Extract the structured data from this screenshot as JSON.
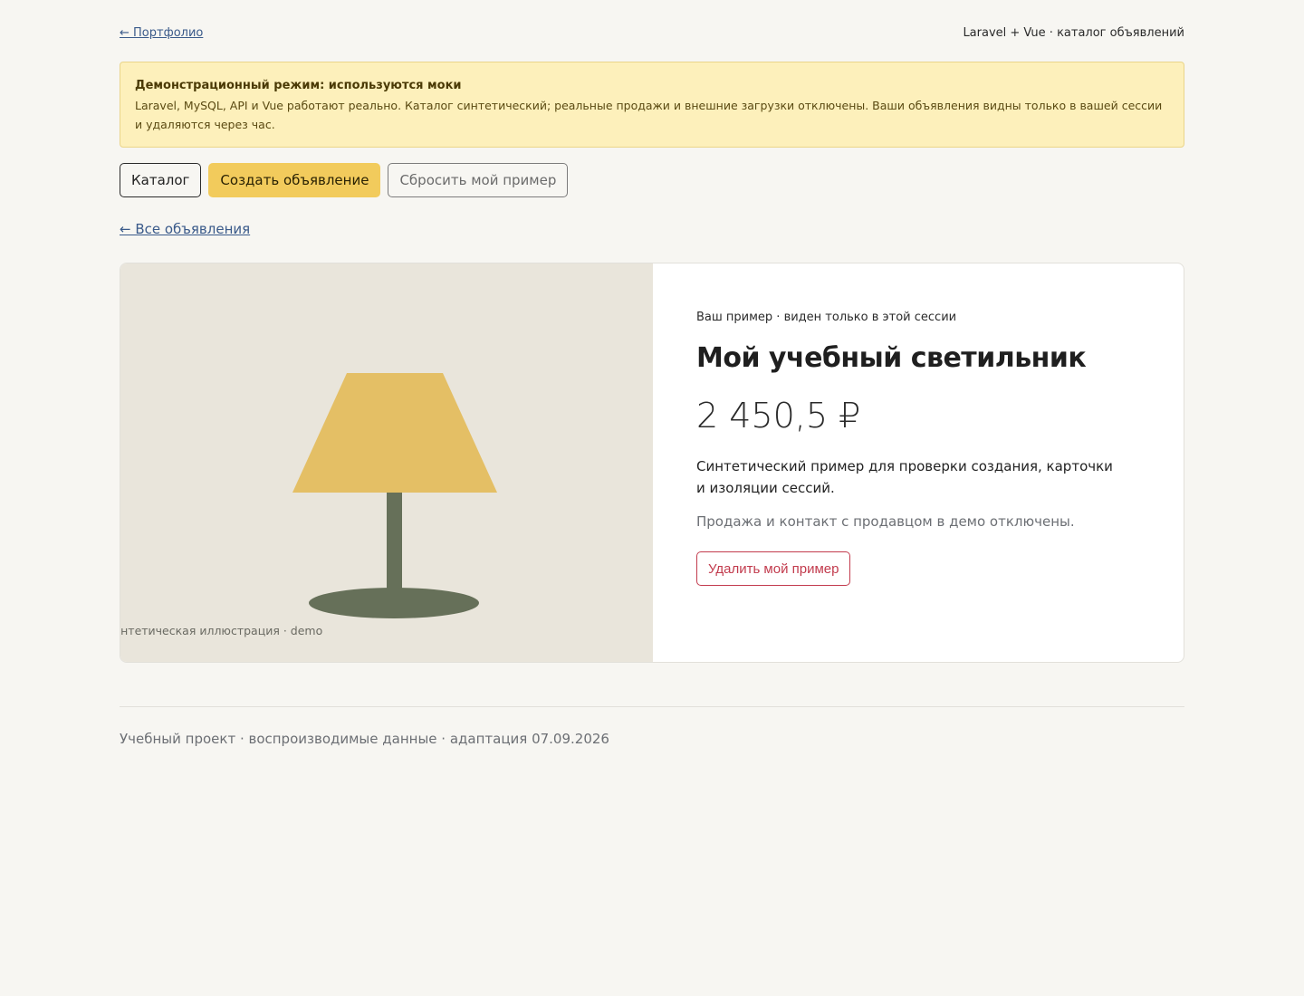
{
  "topbar": {
    "portfolio_link": "← Портфолио",
    "project_label": "Laravel + Vue · каталог объявлений"
  },
  "notice": {
    "title": "Демонстрационный режим: используются моки",
    "text": "Laravel, MySQL, API и Vue работают реально. Каталог синтетический; реальные продажи и внешние загрузки отключены. Ваши объявления видны только в вашей сессии и удаляются через час."
  },
  "actions": {
    "catalog": "Каталог",
    "create": "Создать объявление",
    "reset": "Сбросить мой пример"
  },
  "back_link": "← Все объявления",
  "listing": {
    "image_icon": "lamp-illustration",
    "image_caption": "интетическая иллюстрация · demo",
    "session_note": "Ваш пример · виден только в этой сессии",
    "title": "Мой учебный светильник",
    "price": "2 450,5 ₽",
    "description": "Синтетический пример для проверки создания, карточки и изоляции сессий.",
    "disabled_note": "Продажа и контакт с продавцом в демо отключены.",
    "delete_button": "Удалить мой пример"
  },
  "colors": {
    "accent": "#f2cb5c",
    "danger": "#c23b4d",
    "notice_bg": "#fdf0bb",
    "lamp_shade": "#e4bf65",
    "lamp_stand": "#667059",
    "image_bg": "#e9e5db"
  },
  "footer": {
    "text": "Учебный проект · воспроизводимые данные · адаптация 07.09.2026"
  }
}
